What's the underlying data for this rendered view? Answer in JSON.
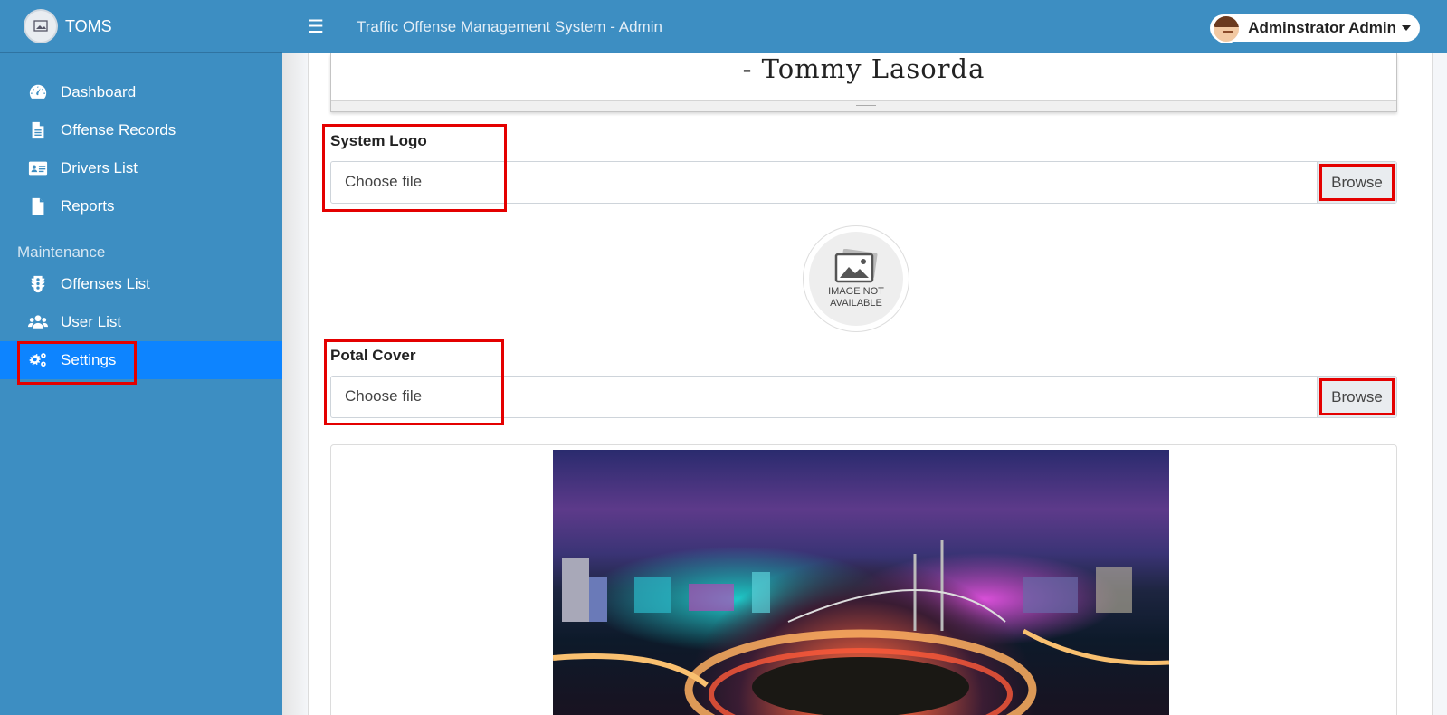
{
  "brand": {
    "name": "TOMS"
  },
  "topbar": {
    "title": "Traffic Offense Management System - Admin",
    "menu_icon": "☰"
  },
  "user": {
    "name": "Adminstrator Admin"
  },
  "sidebar": {
    "items": [
      {
        "label": "Dashboard",
        "icon": "tachometer-icon"
      },
      {
        "label": "Offense Records",
        "icon": "file-icon"
      },
      {
        "label": "Drivers List",
        "icon": "id-card-icon"
      },
      {
        "label": "Reports",
        "icon": "file-icon"
      }
    ],
    "maintenance_header": "Maintenance",
    "maintenance_items": [
      {
        "label": "Offenses List",
        "icon": "traffic-light-icon"
      },
      {
        "label": "User List",
        "icon": "users-icon"
      },
      {
        "label": "Settings",
        "icon": "cogs-icon",
        "active": true
      }
    ]
  },
  "content": {
    "quote_author": "- Tommy Lasorda",
    "system_logo": {
      "label": "System Logo",
      "placeholder": "Choose file",
      "browse_label": "Browse",
      "preview_text_1": "IMAGE NOT",
      "preview_text_2": "AVAILABLE"
    },
    "portal_cover": {
      "label": "Potal Cover",
      "placeholder": "Choose file",
      "browse_label": "Browse"
    }
  },
  "colors": {
    "sidebar": "#3d8ec2",
    "active": "#0d84ff",
    "highlight": "#e40000"
  }
}
